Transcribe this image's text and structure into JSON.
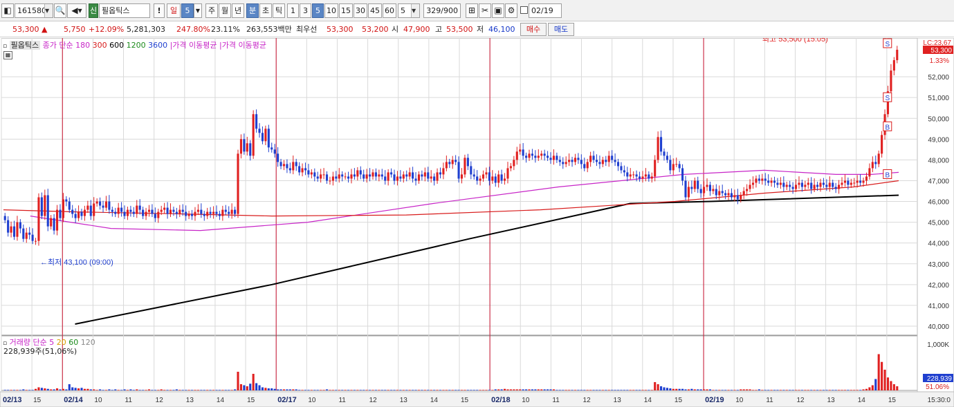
{
  "toolbar": {
    "code": "161580",
    "badge": "신",
    "stock_name": "필옵틱스",
    "alert": "!",
    "period": "일",
    "period_num": "5",
    "btn_week": "주",
    "btn_month": "월",
    "btn_year": "년",
    "btn_min": "분",
    "btn_sec": "초",
    "btn_tick": "틱",
    "intervals": [
      "1",
      "3",
      "5",
      "10",
      "15",
      "30",
      "45",
      "60"
    ],
    "count": "5",
    "range": "329/900",
    "date": "02/19"
  },
  "quote": {
    "price": "53,300",
    "change": "5,750",
    "change_pct": "+12.09%",
    "volume": "5,281,303",
    "vol_ratio": "247.80%",
    "turnover": "23.11%",
    "amount": "263,553백만",
    "best_label": "최우선",
    "ask": "53,300",
    "bid": "53,200",
    "open_label": "시",
    "open": "47,900",
    "high_label": "고",
    "high": "53,500",
    "low_label": "저",
    "low": "46,100",
    "buy": "매수",
    "sell": "매도"
  },
  "price_legend": {
    "name": "필옵틱스",
    "ma_title": "종가 단순",
    "ma_periods": [
      "180",
      "300",
      "600",
      "1200",
      "3600"
    ],
    "ma_label_1": "가격 이동평균",
    "ma_label_2": "가격 이동평균"
  },
  "volume_legend": {
    "title": "거래량",
    "ma_title": "단순",
    "periods": [
      "5",
      "20",
      "60",
      "120"
    ],
    "total": "228,939주(51,06%)"
  },
  "annotations": {
    "high": "최고 53,500 (15:05)",
    "low": "←최저 43,100 (09:00)",
    "lc": "LC:23,67",
    "last_price": "53,300",
    "last_pct": "1.33%",
    "vol_last": "228,939",
    "vol_pct": "51.06%",
    "marker_s": "S",
    "marker_b": "B",
    "time_label": "15:30:0"
  },
  "colors": {
    "up": "#e02020",
    "down": "#1f3fcf",
    "ma_red": "#d81b1b",
    "ma_magenta": "#c724c7",
    "ma_black": "#000000",
    "grid": "#d9d9d9",
    "day_sep": "#c8102e",
    "selected_btn": "#5a86c5"
  },
  "chart_data": {
    "type": "candlestick",
    "ylim": [
      39600,
      53600
    ],
    "y_ticks": [
      40000,
      41000,
      42000,
      43000,
      44000,
      45000,
      46000,
      47000,
      48000,
      49000,
      50000,
      51000,
      52000
    ],
    "x_tick_labels": [
      "02/13",
      "15",
      "02/14",
      "10",
      "11",
      "12",
      "13",
      "14",
      "15",
      "02/17",
      "10",
      "11",
      "12",
      "13",
      "14",
      "15",
      "02/18",
      "10",
      "11",
      "12",
      "13",
      "14",
      "15",
      "02/19",
      "10",
      "11",
      "12",
      "13",
      "14",
      "15"
    ],
    "day_separators": [
      "02/14",
      "02/17",
      "02/18",
      "02/19"
    ],
    "high": 53500,
    "low": 43100,
    "last": 53300,
    "price_series": [
      45100,
      44500,
      44800,
      44300,
      45000,
      44700,
      44200,
      44500,
      44400,
      44100,
      44100,
      46200,
      45300,
      46300,
      44800,
      45200,
      44600,
      45600,
      45200,
      46100,
      46000,
      45600,
      45400,
      45200,
      45500,
      45300,
      45600,
      45800,
      45300,
      45900,
      46000,
      45800,
      45700,
      46000,
      45600,
      45500,
      45400,
      45700,
      45500,
      45300,
      45600,
      45500,
      45400,
      45800,
      45600,
      45300,
      45500,
      45600,
      45400,
      45200,
      45500,
      45600,
      45700,
      45400,
      45600,
      45500,
      45400,
      45600,
      45500,
      45300,
      45400,
      45300,
      45500,
      45600,
      45400,
      45300,
      45500,
      45400,
      45500,
      45400,
      45300,
      45600,
      45500,
      45400,
      45600,
      45400,
      48300,
      49000,
      48400,
      48800,
      48200,
      50200,
      49500,
      49300,
      48900,
      49500,
      48600,
      48500,
      48300,
      47900,
      47700,
      47800,
      47600,
      47500,
      47900,
      47700,
      47400,
      47600,
      47500,
      47300,
      47400,
      47200,
      47100,
      47300,
      47300,
      47000,
      47000,
      47200,
      47100,
      47300,
      47200,
      47200,
      47100,
      47300,
      47200,
      47500,
      47300,
      47100,
      47300,
      47200,
      47400,
      47200,
      47300,
      47200,
      47000,
      47400,
      47300,
      47000,
      47200,
      47100,
      47300,
      47200,
      47400,
      47100,
      47000,
      47300,
      47200,
      47400,
      47100,
      47200,
      47000,
      47400,
      47300,
      47600,
      47900,
      47800,
      48000,
      47900,
      47100,
      47300,
      48100,
      47700,
      47300,
      47200,
      47000,
      47100,
      47300,
      47400,
      47000,
      47200,
      46900,
      47300,
      47000,
      47100,
      47600,
      47700,
      48000,
      48400,
      48500,
      48200,
      48100,
      48300,
      48200,
      48100,
      48200,
      48300,
      48200,
      48100,
      48000,
      48200,
      48000,
      47900,
      47800,
      47900,
      48000,
      47900,
      48100,
      48000,
      47800,
      47600,
      47900,
      48200,
      48000,
      47900,
      47800,
      48000,
      47900,
      48200,
      48000,
      47900,
      47700,
      47500,
      47400,
      47200,
      47300,
      47300,
      47200,
      47100,
      47200,
      47300,
      47100,
      47200,
      48000,
      49100,
      48400,
      48200,
      48000,
      47500,
      47800,
      47800,
      47600,
      47000,
      46200,
      46700,
      46600,
      47000,
      46600,
      46400,
      46700,
      46800,
      46500,
      46600,
      46300,
      46500,
      46400,
      46300,
      46400,
      46200,
      46300,
      46100,
      46300,
      46500,
      46600,
      46800,
      46900,
      47100,
      47000,
      47100,
      47000,
      46900,
      47000,
      46900,
      46800,
      46900,
      46700,
      46800,
      46700,
      46600,
      46800,
      46900,
      46700,
      46800,
      46900,
      46600,
      46800,
      46700,
      46900,
      46800,
      46700,
      46900,
      46700,
      46600,
      46800,
      46900,
      47000,
      46800,
      46900,
      46900,
      47000,
      46900,
      47000,
      47200,
      47600,
      47900,
      47800,
      48300,
      49200,
      50200,
      51300,
      52300,
      52800,
      53300
    ],
    "ma_red": [
      [
        45600,
        0
      ],
      [
        45500,
        0.08
      ],
      [
        45400,
        0.2
      ],
      [
        45300,
        0.3
      ],
      [
        45350,
        0.45
      ],
      [
        45600,
        0.6
      ],
      [
        46000,
        0.75
      ],
      [
        46400,
        0.85
      ],
      [
        46700,
        0.95
      ],
      [
        47000,
        1
      ]
    ],
    "ma_magenta": [
      [
        45300,
        0.03
      ],
      [
        44700,
        0.12
      ],
      [
        44600,
        0.22
      ],
      [
        45000,
        0.34
      ],
      [
        45900,
        0.48
      ],
      [
        46700,
        0.62
      ],
      [
        47300,
        0.76
      ],
      [
        47500,
        0.85
      ],
      [
        47300,
        0.93
      ],
      [
        47300,
        0.97
      ],
      [
        47400,
        1
      ]
    ],
    "ma_black": [
      [
        40100,
        0.08
      ],
      [
        42000,
        0.3
      ],
      [
        44200,
        0.52
      ],
      [
        45900,
        0.7
      ],
      [
        46000,
        0.79
      ],
      [
        46300,
        1
      ]
    ],
    "volume_series": [
      0.01,
      0.01,
      0.01,
      0.01,
      0.01,
      0.01,
      0.02,
      0.01,
      0.01,
      0.01,
      0.03,
      0.06,
      0.05,
      0.04,
      0.03,
      0.02,
      0.02,
      0.04,
      0.02,
      0.03,
      0.02,
      0.12,
      0.06,
      0.05,
      0.04,
      0.05,
      0.03,
      0.03,
      0.02,
      0.02,
      0.01,
      0.02,
      0.01,
      0.01,
      0.02,
      0.01,
      0.02,
      0.01,
      0.01,
      0.02,
      0.01,
      0.02,
      0.01,
      0.02,
      0.01,
      0.01,
      0.01,
      0.02,
      0.01,
      0.01,
      0.01,
      0.02,
      0.01,
      0.01,
      0.01,
      0.01,
      0.02,
      0.01,
      0.01,
      0.01,
      0.01,
      0.01,
      0.01,
      0.01,
      0.01,
      0.01,
      0.01,
      0.01,
      0.01,
      0.01,
      0.01,
      0.01,
      0.01,
      0.01,
      0.01,
      0.02,
      0.36,
      0.12,
      0.1,
      0.08,
      0.13,
      0.32,
      0.14,
      0.1,
      0.06,
      0.05,
      0.04,
      0.04,
      0.03,
      0.02,
      0.02,
      0.02,
      0.02,
      0.02,
      0.02,
      0.02,
      0.01,
      0.01,
      0.01,
      0.01,
      0.01,
      0.01,
      0.01,
      0.01,
      0.01,
      0.02,
      0.01,
      0.01,
      0.01,
      0.01,
      0.01,
      0.01,
      0.01,
      0.01,
      0.01,
      0.01,
      0.01,
      0.01,
      0.01,
      0.01,
      0.01,
      0.01,
      0.01,
      0.01,
      0.01,
      0.01,
      0.01,
      0.01,
      0.01,
      0.01,
      0.01,
      0.01,
      0.01,
      0.01,
      0.01,
      0.01,
      0.01,
      0.01,
      0.01,
      0.01,
      0.01,
      0.01,
      0.01,
      0.01,
      0.01,
      0.01,
      0.01,
      0.01,
      0.01,
      0.01,
      0.01,
      0.01,
      0.01,
      0.01,
      0.01,
      0.01,
      0.01,
      0.01,
      0.01,
      0.01,
      0.02,
      0.02,
      0.02,
      0.03,
      0.02,
      0.02,
      0.02,
      0.02,
      0.02,
      0.02,
      0.02,
      0.02,
      0.02,
      0.02,
      0.02,
      0.02,
      0.02,
      0.02,
      0.02,
      0.02,
      0.01,
      0.01,
      0.01,
      0.01,
      0.01,
      0.01,
      0.01,
      0.01,
      0.01,
      0.01,
      0.01,
      0.01,
      0.01,
      0.01,
      0.01,
      0.01,
      0.01,
      0.01,
      0.01,
      0.01,
      0.01,
      0.01,
      0.01,
      0.01,
      0.01,
      0.01,
      0.01,
      0.01,
      0.01,
      0.01,
      0.01,
      0.01,
      0.16,
      0.12,
      0.08,
      0.06,
      0.05,
      0.04,
      0.03,
      0.03,
      0.03,
      0.03,
      0.02,
      0.02,
      0.03,
      0.02,
      0.02,
      0.02,
      0.02,
      0.02,
      0.02,
      0.01,
      0.01,
      0.01,
      0.01,
      0.01,
      0.01,
      0.01,
      0.01,
      0.01,
      0.02,
      0.02,
      0.02,
      0.02,
      0.01,
      0.01,
      0.02,
      0.01,
      0.01,
      0.01,
      0.01,
      0.01,
      0.01,
      0.01,
      0.01,
      0.01,
      0.01,
      0.01,
      0.01,
      0.01,
      0.01,
      0.01,
      0.01,
      0.01,
      0.01,
      0.01,
      0.01,
      0.01,
      0.01,
      0.01,
      0.01,
      0.01,
      0.01,
      0.01,
      0.01,
      0.01,
      0.01,
      0.01,
      0.01,
      0.01,
      0.02,
      0.03,
      0.06,
      0.1,
      0.22,
      0.7,
      0.55,
      0.4,
      0.25,
      0.18,
      0.12,
      0.08
    ]
  }
}
